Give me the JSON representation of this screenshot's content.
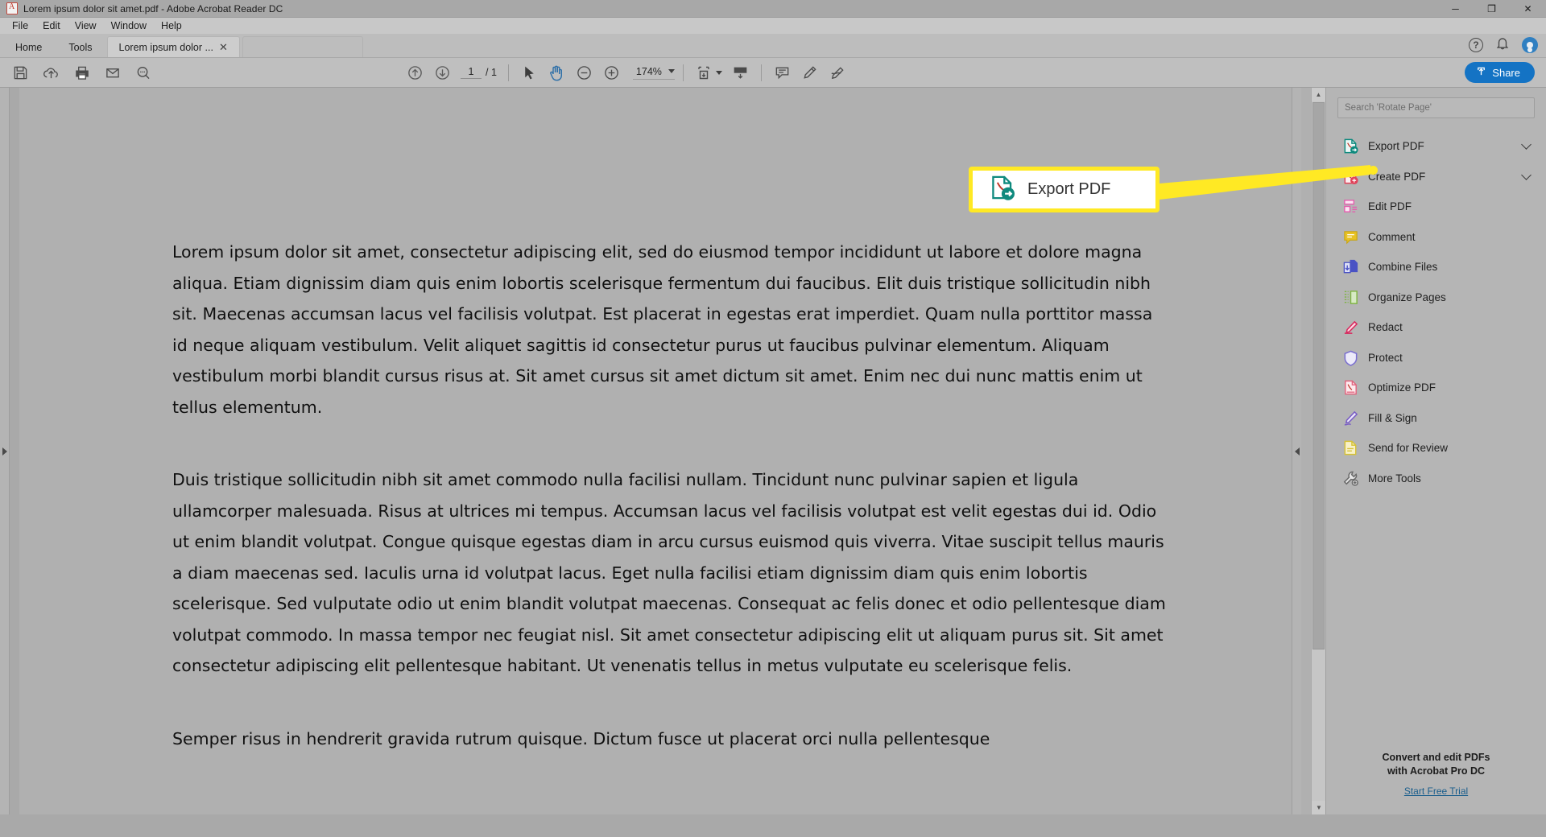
{
  "window": {
    "title": "Lorem ipsum dolor sit amet.pdf - Adobe Acrobat Reader DC",
    "minimize": "─",
    "maximize": "❐",
    "close": "✕"
  },
  "menubar": {
    "items": [
      "File",
      "Edit",
      "View",
      "Window",
      "Help"
    ]
  },
  "tabs": {
    "home": "Home",
    "tools": "Tools",
    "document": "Lorem ipsum dolor ...",
    "close_glyph": "✕",
    "help_glyph": "?",
    "bell_glyph": "🔔"
  },
  "toolbar": {
    "save_icon": "save-icon",
    "upload_icon": "cloud-upload-icon",
    "print_icon": "print-icon",
    "email_icon": "email-icon",
    "search_icon": "search-icon",
    "prev_page_icon": "arrow-up-circle-icon",
    "next_page_icon": "arrow-down-circle-icon",
    "page_current": "1",
    "page_separator": "/ 1",
    "select_tool_icon": "cursor-icon",
    "hand_tool_icon": "hand-icon",
    "zoom_out_icon": "minus-circle-icon",
    "zoom_in_icon": "plus-circle-icon",
    "zoom_level": "174%",
    "fit_page_icon": "fit-page-icon",
    "scroll_mode_icon": "scroll-mode-icon",
    "comment_icon": "comment-icon",
    "highlight_icon": "highlighter-icon",
    "sign_icon": "signature-icon",
    "share_label": "Share",
    "share_icon": "share-upload-icon",
    "share_color": "#1473c4"
  },
  "document": {
    "paragraphs": [
      "Lorem ipsum dolor sit amet, consectetur adipiscing elit, sed do eiusmod tempor incididunt ut labore et dolore magna aliqua. Etiam dignissim diam quis enim lobortis scelerisque fermentum dui faucibus. Elit duis tristique sollicitudin nibh sit. Maecenas accumsan lacus vel facilisis volutpat. Est placerat in egestas erat imperdiet. Quam nulla porttitor massa id neque aliquam vestibulum. Velit aliquet sagittis id consectetur purus ut faucibus pulvinar elementum. Aliquam vestibulum morbi blandit cursus risus at. Sit amet cursus sit amet dictum sit amet. Enim nec dui nunc mattis enim ut tellus elementum.",
      "Duis tristique sollicitudin nibh sit amet commodo nulla facilisi nullam. Tincidunt nunc pulvinar sapien et ligula ullamcorper malesuada. Risus at ultrices mi tempus. Accumsan lacus vel facilisis volutpat est velit egestas dui id. Odio ut enim blandit volutpat. Congue quisque egestas diam in arcu cursus euismod quis viverra. Vitae suscipit tellus mauris a diam maecenas sed. Iaculis urna id volutpat lacus. Eget nulla facilisi etiam dignissim diam quis enim lobortis scelerisque. Sed vulputate odio ut enim blandit volutpat maecenas. Consequat ac felis donec et odio pellentesque diam volutpat commodo. In massa tempor nec feugiat nisl. Sit amet consectetur adipiscing elit ut aliquam purus sit. Sit amet consectetur adipiscing elit pellentesque habitant. Ut venenatis tellus in metus vulputate eu scelerisque felis.",
      "Semper risus in hendrerit gravida rutrum quisque. Dictum fusce ut placerat orci nulla pellentesque"
    ]
  },
  "tools_panel": {
    "search_placeholder": "Search 'Rotate Page'",
    "items": [
      {
        "label": "Export PDF",
        "icon": "export-pdf-icon",
        "color": "#0f8a7e",
        "expandable": true
      },
      {
        "label": "Create PDF",
        "icon": "create-pdf-icon",
        "color": "#e0425a",
        "expandable": true
      },
      {
        "label": "Edit PDF",
        "icon": "edit-pdf-icon",
        "color": "#e35fae",
        "expandable": false
      },
      {
        "label": "Comment",
        "icon": "comment-icon",
        "color": "#e8c224",
        "expandable": false
      },
      {
        "label": "Combine Files",
        "icon": "combine-files-icon",
        "color": "#4a52c4",
        "expandable": false
      },
      {
        "label": "Organize Pages",
        "icon": "organize-pages-icon",
        "color": "#7eb442",
        "expandable": false
      },
      {
        "label": "Redact",
        "icon": "redact-icon",
        "color": "#d8295e",
        "expandable": false
      },
      {
        "label": "Protect",
        "icon": "protect-icon",
        "color": "#7a6fd0",
        "expandable": false
      },
      {
        "label": "Optimize PDF",
        "icon": "optimize-pdf-icon",
        "color": "#e0657e",
        "expandable": false
      },
      {
        "label": "Fill & Sign",
        "icon": "fill-sign-icon",
        "color": "#7a5fc4",
        "expandable": false
      },
      {
        "label": "Send for Review",
        "icon": "send-review-icon",
        "color": "#d6c236",
        "expandable": false
      },
      {
        "label": "More Tools",
        "icon": "more-tools-icon",
        "color": "#6b6b6b",
        "expandable": false
      }
    ],
    "promo_line1": "Convert and edit PDFs",
    "promo_line2": "with Acrobat Pro DC",
    "promo_link": "Start Free Trial"
  },
  "callout": {
    "label": "Export PDF",
    "icon": "export-pdf-icon",
    "border_color": "#ffe924",
    "background": "#ffffff"
  }
}
